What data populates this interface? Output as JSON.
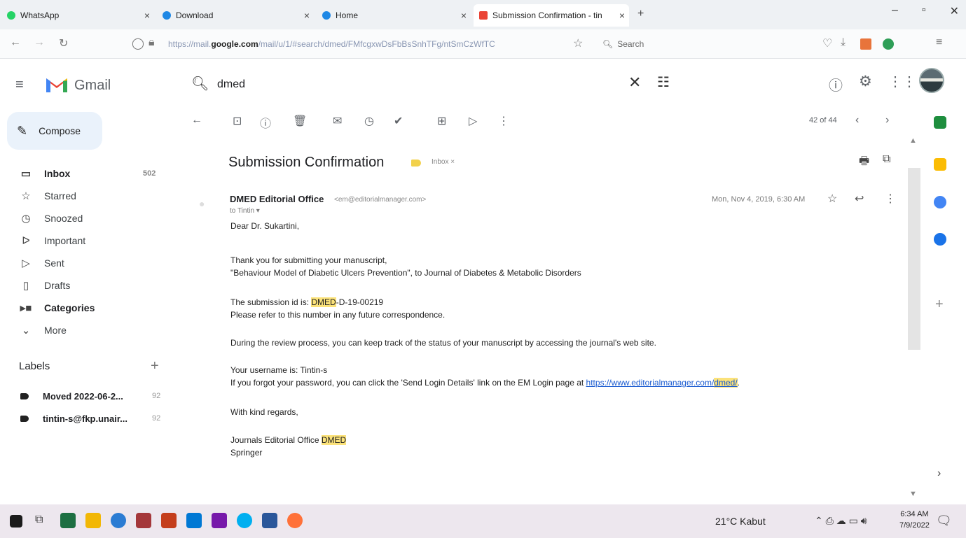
{
  "browser": {
    "tabs": [
      {
        "label": "WhatsApp",
        "color": "#25d366"
      },
      {
        "label": "Download",
        "color": "#1e88e5"
      },
      {
        "label": "Home",
        "color": "#1e88e5"
      },
      {
        "label": "Submission Confirmation - tin",
        "color": "#ea4335"
      }
    ],
    "new_tab": "+",
    "url_prefix": "https://mail.",
    "url_host": "google.com",
    "url_path": "/mail/u/1/#search/dmed/FMfcgxwDsFbBsSnhTFg/ntSmCzWfTC",
    "search_placeholder": "Search"
  },
  "gmail": {
    "logo_text": "Gmail",
    "search_value": "dmed",
    "compose_label": "Compose",
    "nav": [
      {
        "label": "Inbox",
        "count": "502",
        "icon": "inbox-icon",
        "bold": true
      },
      {
        "label": "Starred",
        "count": "",
        "icon": "star-icon"
      },
      {
        "label": "Snoozed",
        "count": "",
        "icon": "clock-icon"
      },
      {
        "label": "Important",
        "count": "",
        "icon": "important-icon"
      },
      {
        "label": "Sent",
        "count": "",
        "icon": "send-icon"
      },
      {
        "label": "Drafts",
        "count": "",
        "icon": "draft-icon"
      },
      {
        "label": "Categories",
        "count": "",
        "icon": "label-icon",
        "bold": true
      },
      {
        "label": "More",
        "count": "",
        "icon": "chevron-down-icon"
      }
    ],
    "labels_title": "Labels",
    "labels": [
      {
        "label": "Moved 2022-06-2...",
        "count": "92"
      },
      {
        "label": "tintin-s@fkp.unair...",
        "count": "92"
      }
    ],
    "pager": "42 of 44",
    "message": {
      "subject": "Submission Confirmation",
      "inbox_chip": "Inbox ×",
      "sender_name": "DMED Editorial Office",
      "sender_email": "<em@editorialmanager.com>",
      "to_line": "to Tintin ▾",
      "date": "Mon, Nov 4, 2019, 6:30 AM",
      "greeting": "Dear Dr. Sukartini,",
      "thanks": "Thank you for submitting your manuscript,",
      "manuscript": "\"Behaviour Model of Diabetic Ulcers Prevention\", to Journal of Diabetes & Metabolic Disorders",
      "id_prefix": "The submission id is: ",
      "id_hl": "DMED",
      "id_rest": "-D-19-00219",
      "refer": "Please refer to this number in any future correspondence.",
      "review": "During the review process, you can keep track of the status of your manuscript by accessing the journal's web site.",
      "username": "Your username is: Tintin-s",
      "forgot_prefix": "If you forgot your password, you can click the 'Send Login Details' link on the EM Login page at ",
      "forgot_link": "https://www.editorialmanager.com/",
      "forgot_link_hl": "dmed/",
      "forgot_suffix": ".",
      "regards": "With kind regards,",
      "sig_prefix": "Journals Editorial Office ",
      "sig_hl": "DMED",
      "springer": "Springer"
    }
  },
  "taskbar": {
    "weather": "21°C  Kabut",
    "time": "6:34 AM",
    "date": "7/9/2022"
  }
}
